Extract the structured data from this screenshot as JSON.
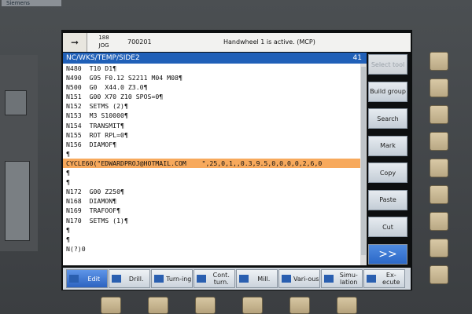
{
  "brand": "Siemens",
  "status": {
    "mode_icon": "arrow-right-icon",
    "jog_top": "188",
    "jog_label": "JOG",
    "program_number": "700201",
    "message": "Handwheel 1 is active. (MCP)"
  },
  "path": {
    "title": "NC/WKS/TEMP/SIDE2",
    "number": "41"
  },
  "editor_lines": [
    "N480  T10 D1¶",
    "N490  G95 F0.12 S2211 M04 M08¶",
    "N500  G0  X44.0 Z3.0¶",
    "N151  G00 X70 Z10 SPOS=0¶",
    "N152  SETMS (2)¶",
    "N153  M3 S10000¶",
    "N154  TRANSMIT¶",
    "N155  ROT RPL=0¶",
    "N156  DIAMOF¶",
    "¶",
    "CYCLE60(\"EDWARDPROJ@HOTMAIL.COM    \",25,0,1,,0.3,9.5,0,0,0,0,2,6,0",
    "¶",
    "¶",
    "N172  G00 Z250¶",
    "N168  DIAMON¶",
    "N169  TRAFOOF¶",
    "N170  SETMS (1)¶",
    "¶",
    "¶",
    "N(?)0  "
  ],
  "right_softkeys": [
    {
      "label": "Select tool",
      "disabled": true
    },
    {
      "label": "Build group",
      "disabled": false
    },
    {
      "label": "Search",
      "disabled": false
    },
    {
      "label": "Mark",
      "disabled": false
    },
    {
      "label": "Copy",
      "disabled": false
    },
    {
      "label": "Paste",
      "disabled": false
    },
    {
      "label": "Cut",
      "disabled": false
    },
    {
      "label": ">>",
      "disabled": false
    }
  ],
  "bottom_softkeys": [
    {
      "label": "Edit",
      "icon": "edit-icon",
      "active": true
    },
    {
      "label": "Drill.",
      "icon": "drill-icon",
      "active": false
    },
    {
      "label": "Turn-ing",
      "icon": "turning-icon",
      "active": false
    },
    {
      "label": "Cont. turn.",
      "icon": "contour-turning-icon",
      "active": false
    },
    {
      "label": "Mill.",
      "icon": "mill-icon",
      "active": false
    },
    {
      "label": "Vari-ous",
      "icon": "various-icon",
      "active": false
    },
    {
      "label": "Simu-lation",
      "icon": "simulation-icon",
      "active": false
    },
    {
      "label": "Ex-ecute",
      "icon": "nc-execute-icon",
      "active": false
    }
  ]
}
